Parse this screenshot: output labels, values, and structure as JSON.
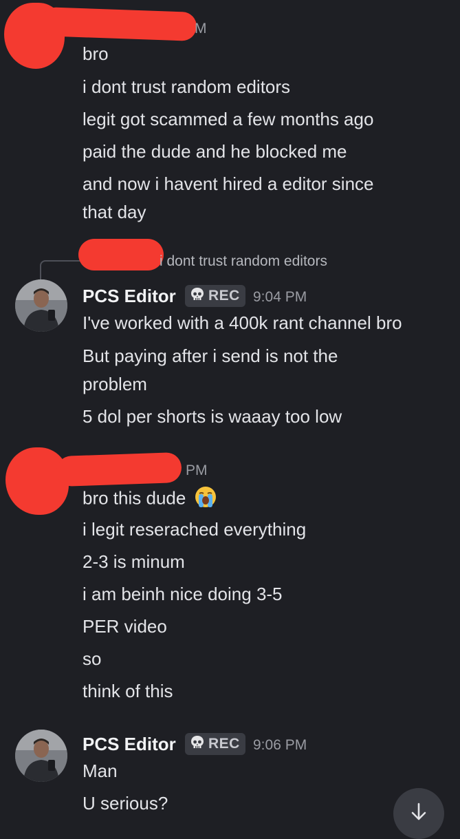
{
  "messages": [
    {
      "id": "m1",
      "author": "",
      "timestamp_partial": "M",
      "lines": [
        "bro",
        "i dont trust random editors",
        "legit got scammed a few months ago",
        "paid the dude and he blocked me",
        "and now i havent hired a editor since",
        "that day"
      ]
    },
    {
      "id": "m2",
      "reply_preview": "i dont trust random editors",
      "author": "PCS Editor",
      "tag": "REC",
      "timestamp": "9:04 PM",
      "lines": [
        "I've worked with a 400k rant channel bro",
        "But paying after i send is not the",
        "problem",
        "5 dol per shorts is waaay too low"
      ]
    },
    {
      "id": "m3",
      "author": "",
      "timestamp_partial": "PM",
      "lines": [
        "bro this dude",
        "i legit reserached everything",
        "2-3 is minum",
        "i am beinh nice doing 3-5",
        "PER video",
        "so",
        "think of this"
      ],
      "emoji": "loudly-crying-face"
    },
    {
      "id": "m4",
      "author": "PCS Editor",
      "tag": "REC",
      "timestamp": "9:06 PM",
      "lines": [
        "Man",
        "U serious?"
      ]
    }
  ],
  "icons": {
    "tag_icon": "skull-icon",
    "scroll": "arrow-down-icon"
  },
  "colors": {
    "background": "#1e1f24",
    "redaction": "#f43a30",
    "tag_bg": "#3a3c43"
  }
}
